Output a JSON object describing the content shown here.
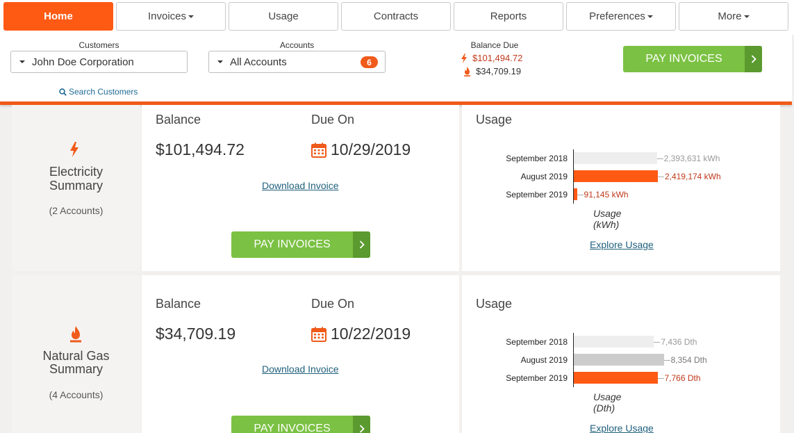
{
  "nav": {
    "tabs": [
      {
        "label": "Home",
        "active": true,
        "dropdown": false
      },
      {
        "label": "Invoices",
        "active": false,
        "dropdown": true
      },
      {
        "label": "Usage",
        "active": false,
        "dropdown": false
      },
      {
        "label": "Contracts",
        "active": false,
        "dropdown": false
      },
      {
        "label": "Reports",
        "active": false,
        "dropdown": false
      },
      {
        "label": "Preferences",
        "active": false,
        "dropdown": true
      },
      {
        "label": "More",
        "active": false,
        "dropdown": true
      }
    ]
  },
  "header": {
    "customers_label": "Customers",
    "customer_value": "John Doe Corporation",
    "search_link": "Search Customers",
    "accounts_label": "Accounts",
    "accounts_value": "All Accounts",
    "accounts_count": "6",
    "balance_label": "Balance Due",
    "balance_electric": "$101,494.72",
    "balance_gas": "$34,709.19",
    "pay_label": "PAY INVOICES"
  },
  "colors": {
    "accent": "#ff5a14",
    "pay_green": "#7bc143",
    "pay_green_dark": "#5a9a2f",
    "link": "#1e5f7c"
  },
  "sections": [
    {
      "icon": "lightning-icon",
      "title_line1": "Electricity",
      "title_line2": "Summary",
      "accounts": "(2 Accounts)",
      "balance_label": "Balance",
      "balance": "$101,494.72",
      "due_label": "Due On",
      "due_date": "10/29/2019",
      "download_label": "Download Invoice",
      "pay_label": "PAY INVOICES",
      "usage_title": "Usage",
      "explore_label": "Explore Usage",
      "chart_data": {
        "type": "bar",
        "orientation": "horizontal",
        "categories": [
          "September 2018",
          "August 2019",
          "September 2019"
        ],
        "values": [
          2393631,
          2419174,
          91145
        ],
        "value_labels": [
          "2,393,631 kWh",
          "2,419,174 kWh",
          "91,145 kWh"
        ],
        "bar_colors": [
          "#eeeeee",
          "#ff5a14",
          "#ff5a14"
        ],
        "label_colors": [
          "#999999",
          "#c0391a",
          "#c0391a"
        ],
        "xlabel": "Usage (kWh)",
        "xlim": [
          0,
          2700000
        ]
      }
    },
    {
      "icon": "flame-icon",
      "title_line1": "Natural Gas",
      "title_line2": "Summary",
      "accounts": "(4 Accounts)",
      "balance_label": "Balance",
      "balance": "$34,709.19",
      "due_label": "Due On",
      "due_date": "10/22/2019",
      "download_label": "Download Invoice",
      "pay_label": "PAY INVOICES",
      "usage_title": "Usage",
      "explore_label": "Explore Usage",
      "chart_data": {
        "type": "bar",
        "orientation": "horizontal",
        "categories": [
          "September 2018",
          "August 2019",
          "September 2019"
        ],
        "values": [
          7436,
          8354,
          7766
        ],
        "value_labels": [
          "7,436 Dth",
          "8,354 Dth",
          "7,766 Dth"
        ],
        "bar_colors": [
          "#eeeeee",
          "#cccccc",
          "#ff5a14"
        ],
        "label_colors": [
          "#999999",
          "#777777",
          "#c0391a"
        ],
        "xlabel": "Usage (Dth)",
        "xlim": [
          0,
          8700
        ]
      }
    }
  ]
}
